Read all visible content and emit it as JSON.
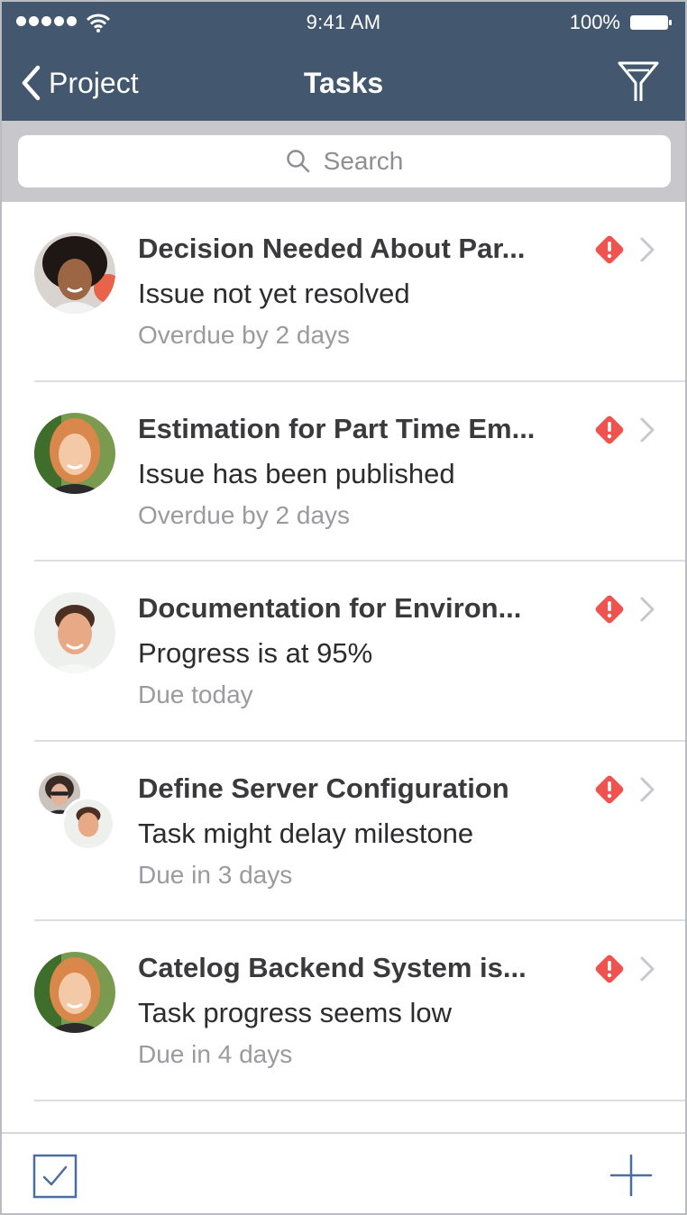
{
  "status_bar": {
    "time": "9:41 AM",
    "battery": "100%"
  },
  "nav": {
    "back_label": "Project",
    "title": "Tasks"
  },
  "search": {
    "placeholder": "Search"
  },
  "tasks": [
    {
      "title": "Decision Needed About Par...",
      "subtitle": "Issue not yet resolved",
      "due": "Overdue by 2 days"
    },
    {
      "title": "Estimation for Part Time Em...",
      "subtitle": "Issue has been published",
      "due": "Overdue by 2 days"
    },
    {
      "title": "Documentation for Environ...",
      "subtitle": "Progress is at 95%",
      "due": "Due today"
    },
    {
      "title": "Define Server Configuration",
      "subtitle": "Task might delay milestone",
      "due": "Due in 3 days"
    },
    {
      "title": "Catelog Backend System is...",
      "subtitle": "Task progress seems low",
      "due": "Due in 4 days"
    }
  ],
  "colors": {
    "header": "#43586f",
    "alert": "#ef5350",
    "accent": "#4a6ea0"
  },
  "icons": {
    "back": "chevron-left-icon",
    "filter": "filter-icon",
    "search": "search-icon",
    "alert": "alert-icon",
    "chevron": "chevron-right-icon",
    "tasks": "checkbox-icon",
    "add": "plus-icon"
  }
}
